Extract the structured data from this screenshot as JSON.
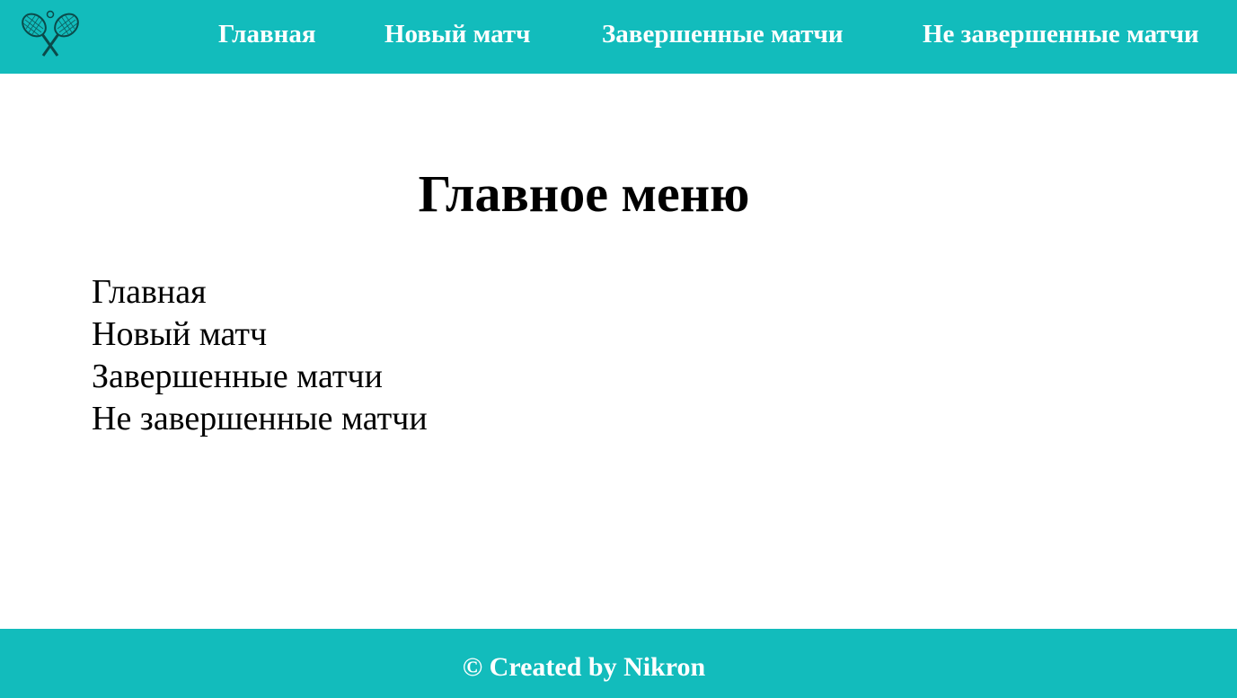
{
  "header": {
    "logo_icon": "tennis-rackets-icon",
    "nav": [
      {
        "label": "Главная"
      },
      {
        "label": "Новый матч"
      },
      {
        "label": "Завершенные матчи"
      },
      {
        "label": "Не завершенные матчи"
      }
    ]
  },
  "main": {
    "title": "Главное меню",
    "menu": [
      {
        "label": "Главная"
      },
      {
        "label": "Новый матч"
      },
      {
        "label": "Завершенные матчи"
      },
      {
        "label": "Не завершенные матчи"
      }
    ]
  },
  "footer": {
    "text": "© Created by Nikron"
  },
  "colors": {
    "accent": "#12bcbc",
    "text": "#000000",
    "nav_text": "#ffffff"
  }
}
